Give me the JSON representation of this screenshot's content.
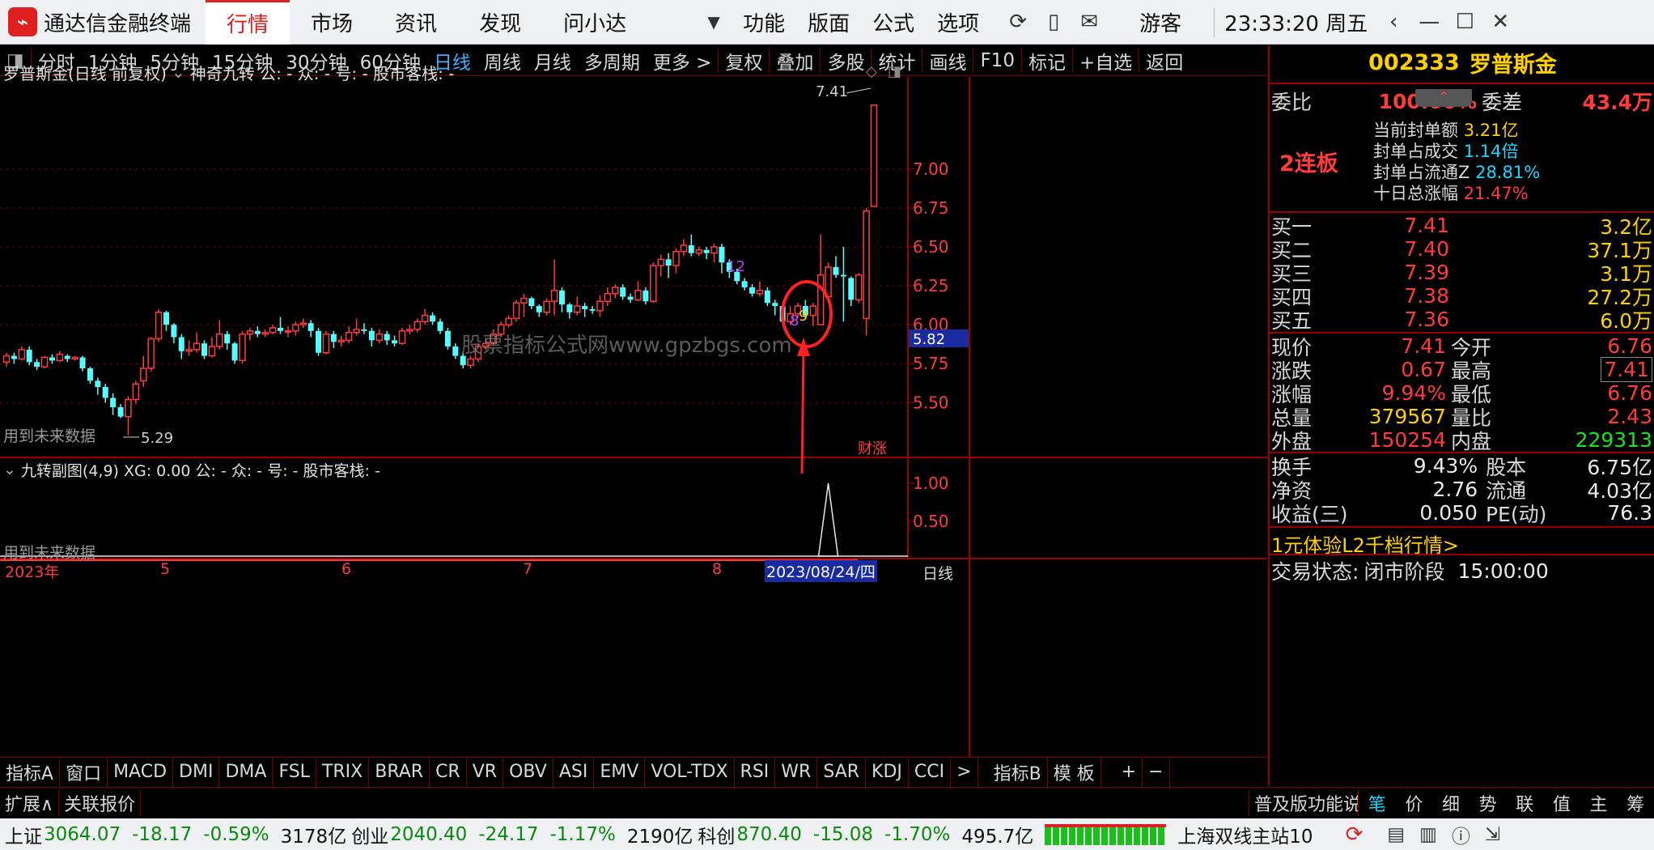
{
  "app": {
    "title": "通达信金融终端",
    "time": "23:33:20 周五",
    "user": "游客"
  },
  "top_nav": [
    "行情",
    "市场",
    "资讯",
    "发现",
    "问小达"
  ],
  "top_menu": [
    "功能",
    "版面",
    "公式",
    "选项"
  ],
  "toolbar": {
    "periods": [
      "分时",
      "1分钟",
      "5分钟",
      "15分钟",
      "30分钟",
      "60分钟",
      "日线",
      "周线",
      "月线",
      "多周期",
      "更多 >"
    ],
    "actions": [
      "复权",
      "叠加",
      "多股",
      "统计",
      "画线",
      "F10",
      "标记",
      "+自选",
      "返回"
    ]
  },
  "main_chart": {
    "header": "罗普斯金(日线 前复权)",
    "indicator": "神奇九转  公: -  众: -  号: -  股市客栈: -",
    "future_note": "用到未来数据",
    "watermark": "股票指标公式网www.gpzbgs.com",
    "badge": "财涨",
    "current_price_tag": "5.82",
    "high_label": "7.41",
    "low_label": "5.29",
    "nine_labels": [
      "12",
      "8",
      "9"
    ]
  },
  "sub_chart": {
    "header": "九转副图(4,9)  XG: 0.00  公: -  众: -  号: -  股市客栈: -",
    "future_note": "用到未来数据",
    "y_ticks": [
      "1.00",
      "0.50"
    ]
  },
  "date_axis": {
    "labels": [
      "2023年",
      "5",
      "6",
      "7",
      "8"
    ],
    "cursor_date": "2023/08/24/四",
    "period": "日线"
  },
  "indicator_tabs": [
    "指标A",
    "窗口",
    "MACD",
    "DMI",
    "DMA",
    "FSL",
    "TRIX",
    "BRAR",
    "CR",
    "VR",
    "OBV",
    "ASI",
    "EMV",
    "VOL-TDX",
    "RSI",
    "WR",
    "SAR",
    "KDJ",
    "CCI",
    ">",
    "指标B",
    "模 板",
    "+",
    "−"
  ],
  "ext_bar": {
    "left": [
      "扩展∧",
      "关联报价"
    ],
    "help": "普及版功能说明",
    "tabs": [
      "笔",
      "价",
      "细",
      "势",
      "联",
      "值",
      "主",
      "筹"
    ]
  },
  "right_panel": {
    "code": "002333",
    "name": "罗普斯金",
    "weibi_label": "委比",
    "weibi": "100.00%",
    "weicha_label": "委差",
    "weicha": "43.4万",
    "lianban": "2连板",
    "seal": [
      {
        "label": "当前封单额",
        "value": "3.21亿"
      },
      {
        "label": "封单占成交",
        "value": "1.14倍"
      },
      {
        "label": "封单占流通Z",
        "value": "28.81%"
      },
      {
        "label": "十日总涨幅",
        "value": "21.47%"
      }
    ],
    "bids": [
      {
        "label": "买一",
        "price": "7.41",
        "vol": "3.2亿"
      },
      {
        "label": "买二",
        "price": "7.40",
        "vol": "37.1万"
      },
      {
        "label": "买三",
        "price": "7.39",
        "vol": "3.1万"
      },
      {
        "label": "买四",
        "price": "7.38",
        "vol": "27.2万"
      },
      {
        "label": "买五",
        "price": "7.36",
        "vol": "6.0万"
      }
    ],
    "quote": [
      {
        "l1": "现价",
        "v1": "7.41",
        "c1": "red",
        "l2": "今开",
        "v2": "6.76",
        "c2": "red"
      },
      {
        "l1": "涨跌",
        "v1": "0.67",
        "c1": "red",
        "l2": "最高",
        "v2": "7.41",
        "c2": "red"
      },
      {
        "l1": "涨幅",
        "v1": "9.94%",
        "c1": "red",
        "l2": "最低",
        "v2": "6.76",
        "c2": "red"
      },
      {
        "l1": "总量",
        "v1": "379567",
        "c1": "yel",
        "l2": "量比",
        "v2": "2.43",
        "c2": "red"
      },
      {
        "l1": "外盘",
        "v1": "150254",
        "c1": "red",
        "l2": "内盘",
        "v2": "229313",
        "c2": "grn"
      }
    ],
    "fund": [
      {
        "l1": "换手",
        "v1": "9.43%",
        "l2": "股本",
        "v2": "6.75亿"
      },
      {
        "l1": "净资",
        "v1": "2.76",
        "l2": "流通",
        "v2": "4.03亿"
      },
      {
        "l1": "收益(三)",
        "v1": "0.050",
        "l2": "PE(动)",
        "v2": "76.3"
      }
    ],
    "promo": "1元体验L2千档行情>",
    "trade_state_label": "交易状态:",
    "trade_state": "闭市阶段",
    "trade_time": "15:00:00"
  },
  "status_bar": {
    "items": [
      {
        "name": "上证",
        "price": "3064.07",
        "chg": "-18.17",
        "pct": "-0.59%",
        "amt": "3178亿"
      },
      {
        "name": "创业",
        "price": "2040.40",
        "chg": "-24.17",
        "pct": "-1.17%",
        "amt": "2190亿"
      },
      {
        "name": "科创",
        "price": "870.40",
        "chg": "-15.08",
        "pct": "-1.70%",
        "amt": "495.7亿"
      }
    ],
    "station": "上海双线主站10"
  },
  "chart_data": {
    "type": "candlestick",
    "y_ticks": [
      "7.00",
      "6.75",
      "6.50",
      "6.25",
      "6.00",
      "5.75",
      "5.50"
    ],
    "ylim": [
      5.2,
      7.55
    ],
    "candles": [
      [
        5.76,
        5.8,
        5.73,
        5.82
      ],
      [
        5.8,
        5.78,
        5.75,
        5.82
      ],
      [
        5.78,
        5.84,
        5.77,
        5.86
      ],
      [
        5.84,
        5.76,
        5.74,
        5.86
      ],
      [
        5.76,
        5.73,
        5.71,
        5.78
      ],
      [
        5.73,
        5.79,
        5.72,
        5.8
      ],
      [
        5.79,
        5.77,
        5.75,
        5.81
      ],
      [
        5.77,
        5.81,
        5.76,
        5.83
      ],
      [
        5.8,
        5.78,
        5.76,
        5.81
      ],
      [
        5.78,
        5.79,
        5.77,
        5.8
      ],
      [
        5.79,
        5.72,
        5.7,
        5.8
      ],
      [
        5.72,
        5.64,
        5.62,
        5.73
      ],
      [
        5.64,
        5.6,
        5.55,
        5.66
      ],
      [
        5.6,
        5.53,
        5.5,
        5.62
      ],
      [
        5.53,
        5.47,
        5.42,
        5.56
      ],
      [
        5.47,
        5.41,
        5.4,
        5.49
      ],
      [
        5.41,
        5.52,
        5.29,
        5.54
      ],
      [
        5.52,
        5.62,
        5.49,
        5.64
      ],
      [
        5.64,
        5.72,
        5.6,
        5.8
      ],
      [
        5.72,
        5.91,
        5.7,
        5.92
      ],
      [
        5.91,
        6.08,
        5.89,
        6.1
      ],
      [
        6.08,
        6.0,
        5.96,
        6.09
      ],
      [
        6.0,
        5.92,
        5.88,
        6.01
      ],
      [
        5.92,
        5.83,
        5.78,
        5.94
      ],
      [
        5.83,
        5.84,
        5.8,
        5.9
      ],
      [
        5.84,
        5.88,
        5.82,
        5.95
      ],
      [
        5.88,
        5.8,
        5.78,
        5.9
      ],
      [
        5.8,
        5.86,
        5.79,
        5.92
      ],
      [
        5.86,
        5.94,
        5.84,
        6.03
      ],
      [
        5.94,
        5.88,
        5.84,
        5.96
      ],
      [
        5.88,
        5.77,
        5.75,
        5.89
      ],
      [
        5.77,
        5.94,
        5.75,
        5.96
      ],
      [
        5.94,
        5.96,
        5.9,
        5.98
      ],
      [
        5.96,
        5.94,
        5.92,
        5.99
      ],
      [
        5.94,
        5.95,
        5.92,
        5.97
      ],
      [
        5.95,
        5.98,
        5.94,
        6.0
      ],
      [
        5.98,
        5.96,
        5.94,
        6.05
      ],
      [
        5.96,
        5.96,
        5.92,
        5.99
      ],
      [
        5.96,
        6.0,
        5.93,
        6.02
      ],
      [
        6.0,
        6.01,
        5.98,
        6.04
      ],
      [
        6.01,
        5.96,
        5.92,
        6.03
      ],
      [
        5.96,
        5.82,
        5.8,
        5.98
      ],
      [
        5.82,
        5.94,
        5.81,
        5.96
      ],
      [
        5.94,
        5.89,
        5.85,
        5.96
      ],
      [
        5.89,
        5.9,
        5.86,
        5.93
      ],
      [
        5.9,
        5.95,
        5.88,
        5.99
      ],
      [
        5.95,
        5.97,
        5.93,
        6.04
      ],
      [
        5.97,
        5.96,
        5.94,
        6.01
      ],
      [
        5.96,
        5.9,
        5.86,
        5.98
      ],
      [
        5.9,
        5.94,
        5.88,
        5.97
      ],
      [
        5.94,
        5.9,
        5.87,
        5.96
      ],
      [
        5.9,
        5.88,
        5.86,
        5.93
      ],
      [
        5.88,
        5.96,
        5.87,
        5.98
      ],
      [
        5.96,
        5.97,
        5.94,
        6.0
      ],
      [
        5.97,
        6.02,
        5.95,
        6.04
      ],
      [
        6.02,
        6.06,
        6.0,
        6.1
      ],
      [
        6.06,
        6.02,
        6.0,
        6.08
      ],
      [
        6.02,
        5.96,
        5.94,
        6.04
      ],
      [
        5.96,
        5.86,
        5.84,
        5.98
      ],
      [
        5.86,
        5.8,
        5.78,
        5.88
      ],
      [
        5.8,
        5.74,
        5.72,
        5.82
      ],
      [
        5.74,
        5.78,
        5.72,
        5.8
      ],
      [
        5.78,
        5.86,
        5.76,
        5.88
      ],
      [
        5.86,
        5.88,
        5.84,
        5.91
      ],
      [
        5.88,
        5.94,
        5.87,
        5.97
      ],
      [
        5.94,
        6.0,
        5.92,
        6.02
      ],
      [
        6.0,
        6.04,
        5.98,
        6.06
      ],
      [
        6.04,
        6.14,
        6.02,
        6.16
      ],
      [
        6.14,
        6.17,
        6.05,
        6.2
      ],
      [
        6.17,
        6.12,
        6.1,
        6.18
      ],
      [
        6.12,
        6.08,
        6.05,
        6.13
      ],
      [
        6.08,
        6.15,
        6.06,
        6.17
      ],
      [
        6.15,
        6.22,
        6.06,
        6.42
      ],
      [
        6.22,
        6.13,
        6.08,
        6.24
      ],
      [
        6.13,
        6.08,
        6.04,
        6.14
      ],
      [
        6.08,
        6.12,
        6.06,
        6.18
      ],
      [
        6.12,
        6.1,
        6.05,
        6.14
      ],
      [
        6.1,
        6.09,
        6.07,
        6.12
      ],
      [
        6.09,
        6.15,
        6.05,
        6.19
      ],
      [
        6.15,
        6.2,
        6.12,
        6.24
      ],
      [
        6.2,
        6.24,
        6.17,
        6.26
      ],
      [
        6.24,
        6.18,
        6.16,
        6.26
      ],
      [
        6.18,
        6.16,
        6.14,
        6.2
      ],
      [
        6.16,
        6.22,
        6.15,
        6.28
      ],
      [
        6.22,
        6.15,
        6.13,
        6.24
      ],
      [
        6.15,
        6.38,
        6.14,
        6.4
      ],
      [
        6.38,
        6.42,
        6.31,
        6.45
      ],
      [
        6.42,
        6.38,
        6.3,
        6.46
      ],
      [
        6.38,
        6.47,
        6.33,
        6.49
      ],
      [
        6.47,
        6.51,
        6.44,
        6.55
      ],
      [
        6.51,
        6.46,
        6.44,
        6.58
      ],
      [
        6.46,
        6.48,
        6.44,
        6.5
      ],
      [
        6.48,
        6.46,
        6.42,
        6.5
      ],
      [
        6.46,
        6.5,
        6.4,
        6.52
      ],
      [
        6.5,
        6.4,
        6.33,
        6.52
      ],
      [
        6.4,
        6.34,
        6.3,
        6.42
      ],
      [
        6.34,
        6.28,
        6.26,
        6.36
      ],
      [
        6.28,
        6.24,
        6.22,
        6.3
      ],
      [
        6.24,
        6.2,
        6.18,
        6.26
      ],
      [
        6.2,
        6.22,
        6.18,
        6.28
      ],
      [
        6.22,
        6.14,
        6.12,
        6.24
      ],
      [
        6.14,
        6.12,
        6.06,
        6.16
      ],
      [
        6.12,
        6.02,
        6.0,
        6.14
      ],
      [
        6.02,
        6.07,
        6.0,
        6.12
      ],
      [
        6.07,
        6.12,
        6.04,
        6.14
      ],
      [
        6.12,
        6.06,
        6.04,
        6.16
      ],
      [
        6.06,
        6.12,
        5.99,
        6.14
      ],
      [
        6.0,
        6.32,
        6.0,
        6.58
      ],
      [
        6.18,
        6.37,
        6.15,
        6.4
      ],
      [
        6.37,
        6.32,
        6.3,
        6.44
      ],
      [
        6.32,
        6.31,
        6.02,
        6.5
      ],
      [
        6.3,
        6.16,
        6.12,
        6.31
      ],
      [
        6.16,
        6.32,
        6.14,
        6.33
      ],
      [
        6.04,
        6.73,
        5.93,
        6.75
      ],
      [
        6.76,
        7.41,
        6.76,
        7.41
      ]
    ],
    "signal_series": {
      "name": "XG",
      "peak_value": 1.0,
      "peak_index": 108
    }
  }
}
